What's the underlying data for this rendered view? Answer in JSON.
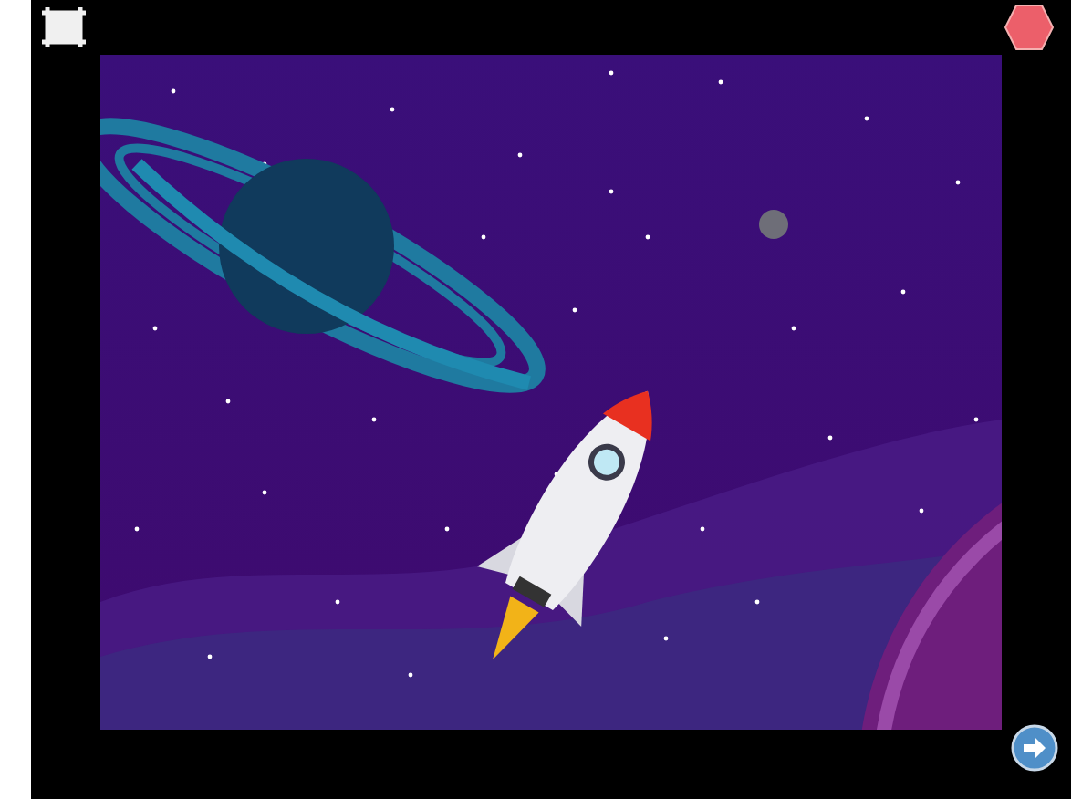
{
  "stage": {
    "kind": "space-scene"
  }
}
